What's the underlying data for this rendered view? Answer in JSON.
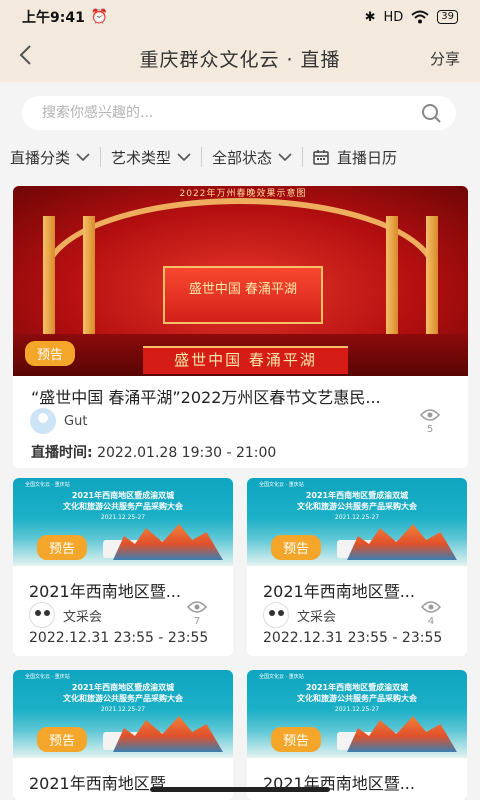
{
  "status_bar": {
    "time": "上午9:41",
    "network": "HD",
    "battery": "39"
  },
  "header": {
    "back_icon": "chevron-left",
    "title": "重庆群众文化云 · 直播",
    "share_label": "分享"
  },
  "search": {
    "placeholder": "搜索你感兴趣的..."
  },
  "filters": [
    {
      "label": "直播分类",
      "icon": "chevron-down"
    },
    {
      "label": "艺术类型",
      "icon": "chevron-down"
    },
    {
      "label": "全部状态",
      "icon": "chevron-down"
    },
    {
      "label": "直播日历",
      "icon": "calendar"
    }
  ],
  "featured": {
    "poster_caption": "2022年万州春晚效果示意图",
    "poster_screen": "盛世中国 春涌平湖",
    "poster_banner": "盛世中国  春涌平湖",
    "tag": "预告",
    "title": "“盛世中国 春涌平湖”2022万州区春节文艺惠民...",
    "owner": "Gut",
    "views": "5",
    "time_label": "直播时间:",
    "time_value": "2022.01.28 19:30 - 21:00"
  },
  "cards": [
    {
      "poster_top": "全国文化云 · 重庆站",
      "poster_title_1": "2021年西南地区暨成渝双城",
      "poster_title_2": "文化和旅游公共服务产品采购大会",
      "poster_date": "2021.12.25-27",
      "tag": "预告",
      "title": "2021年西南地区暨...",
      "owner": "文采会",
      "views": "7",
      "time": "2022.12.31 23:55 - 23:55"
    },
    {
      "poster_top": "全国文化云 · 重庆站",
      "poster_title_1": "2021年西南地区暨成渝双城",
      "poster_title_2": "文化和旅游公共服务产品采购大会",
      "poster_date": "2021.12.25-27",
      "tag": "预告",
      "title": "2021年西南地区暨...",
      "owner": "文采会",
      "views": "4",
      "time": "2022.12.31 23:55 - 23:55"
    },
    {
      "poster_top": "全国文化云 · 重庆站",
      "poster_title_1": "2021年西南地区暨成渝双城",
      "poster_title_2": "文化和旅游公共服务产品采购大会",
      "poster_date": "2021.12.25-27",
      "tag": "预告",
      "title": "2021年西南地区暨..."
    },
    {
      "poster_top": "全国文化云 · 重庆站",
      "poster_title_1": "2021年西南地区暨成渝双城",
      "poster_title_2": "文化和旅游公共服务产品采购大会",
      "poster_date": "2021.12.25-27",
      "tag": "预告",
      "title": "2021年西南地区暨..."
    }
  ],
  "colors": {
    "header_bg": "#f3e9dc",
    "tag_bg": "#f4a62a",
    "page_bg": "#f4f4f4"
  }
}
